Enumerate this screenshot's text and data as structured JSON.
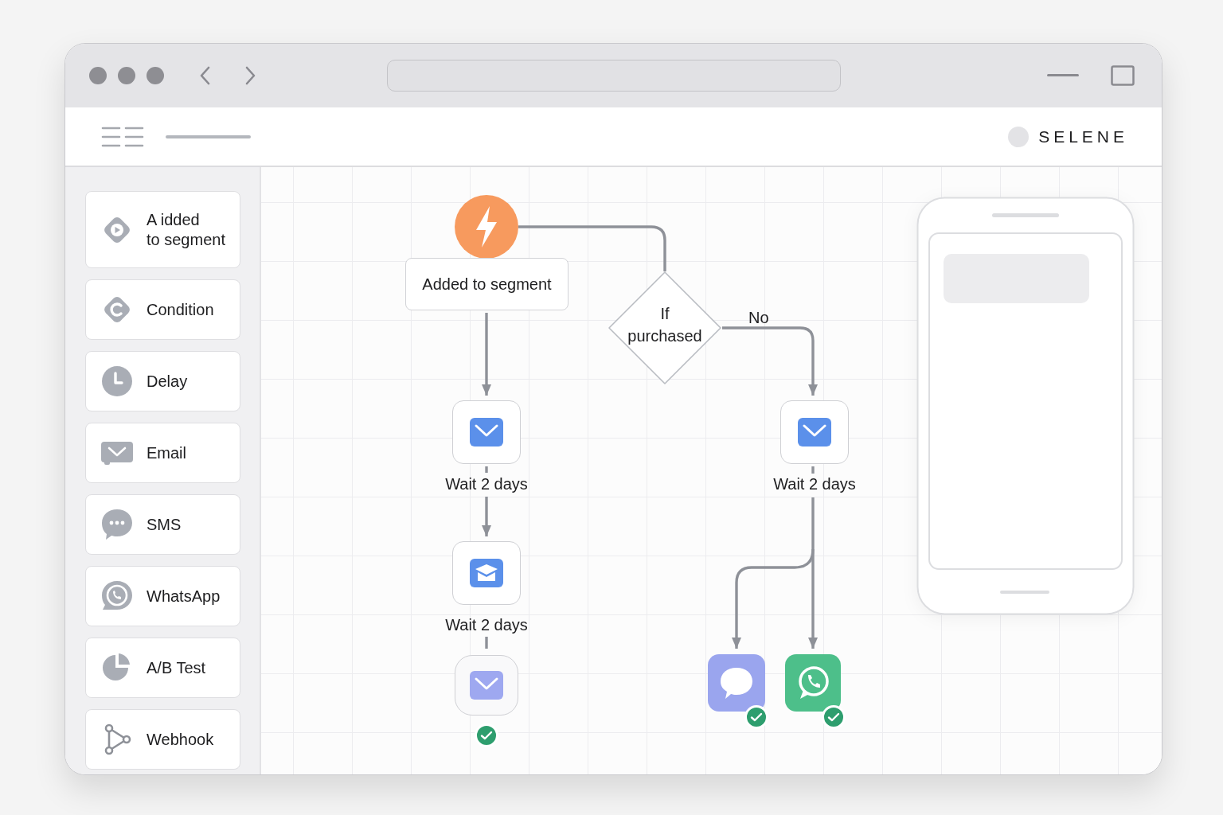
{
  "header": {
    "brand": "SELENE"
  },
  "sidebar": {
    "items": [
      {
        "kind": "trigger",
        "label": "A idded\nto segment"
      },
      {
        "kind": "condition",
        "label": "Condition"
      },
      {
        "kind": "delay",
        "label": "Delay"
      },
      {
        "kind": "email",
        "label": "Email"
      },
      {
        "kind": "sms",
        "label": "SMS"
      },
      {
        "kind": "whatsapp",
        "label": "WhatsApp"
      },
      {
        "kind": "abtest",
        "label": "A/B Test"
      },
      {
        "kind": "webhook",
        "label": "Webhook"
      }
    ]
  },
  "flow": {
    "trigger": {
      "label": "Added to segment"
    },
    "condition": {
      "label": "If\npurchased",
      "branch_label": "No"
    },
    "nodes": [
      {
        "kind": "email",
        "caption": "Wait 2 days",
        "completed": false
      },
      {
        "kind": "email-open",
        "caption": "Wait 2 days",
        "completed": false
      },
      {
        "kind": "email-soft",
        "completed": true
      },
      {
        "kind": "email",
        "caption": "Wait 2 days",
        "completed": false
      },
      {
        "kind": "sms",
        "completed": true
      },
      {
        "kind": "whatsapp",
        "completed": true
      }
    ]
  }
}
